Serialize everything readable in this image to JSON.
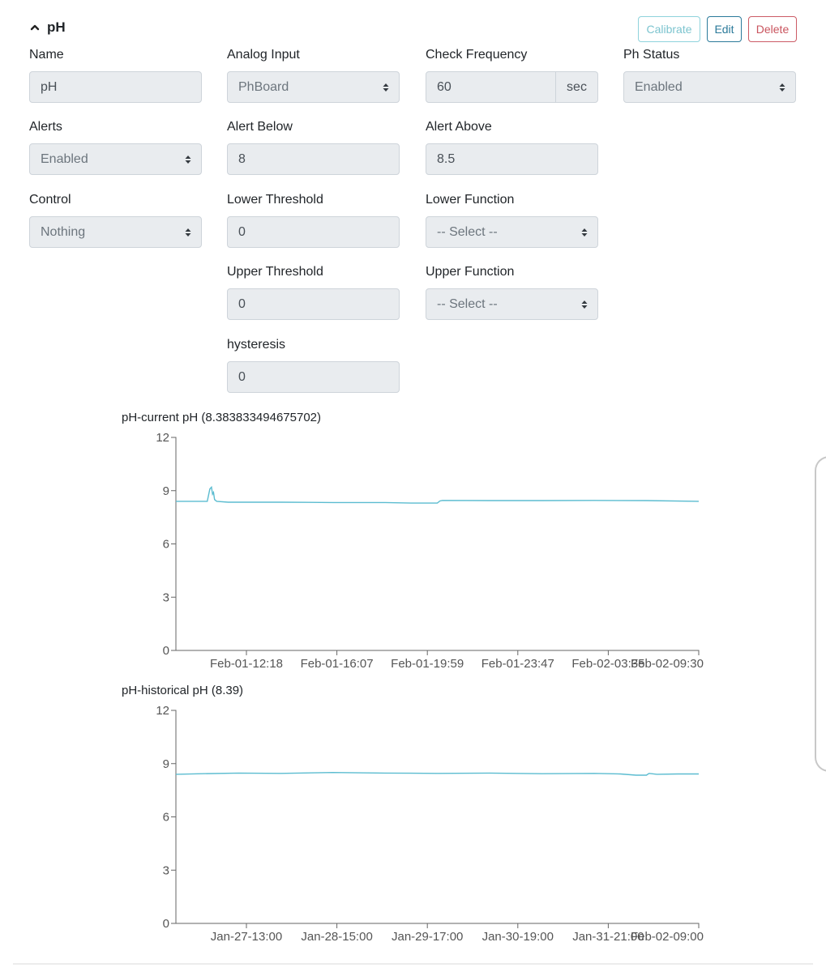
{
  "section": {
    "title": "pH",
    "collapse_icon": "chevron-up-icon"
  },
  "actions": {
    "calibrate": "Calibrate",
    "edit": "Edit",
    "delete": "Delete"
  },
  "fields": {
    "name": {
      "label": "Name",
      "value": "pH"
    },
    "analog_input": {
      "label": "Analog Input",
      "value": "PhBoard"
    },
    "check_frequency": {
      "label": "Check Frequency",
      "value": "60",
      "unit": "sec"
    },
    "ph_status": {
      "label": "Ph Status",
      "value": "Enabled"
    },
    "alerts": {
      "label": "Alerts",
      "value": "Enabled"
    },
    "alert_below": {
      "label": "Alert Below",
      "value": "8"
    },
    "alert_above": {
      "label": "Alert Above",
      "value": "8.5"
    },
    "control": {
      "label": "Control",
      "value": "Nothing"
    },
    "lower_threshold": {
      "label": "Lower Threshold",
      "value": "0"
    },
    "lower_function": {
      "label": "Lower Function",
      "value": "-- Select --"
    },
    "upper_threshold": {
      "label": "Upper Threshold",
      "value": "0"
    },
    "upper_function": {
      "label": "Upper Function",
      "value": "-- Select --"
    },
    "hysteresis": {
      "label": "hysteresis",
      "value": "0"
    }
  },
  "chart_data": [
    {
      "type": "line",
      "title": "pH-current pH (8.383833494675702)",
      "xlabel": "",
      "ylabel": "",
      "ylim": [
        0,
        12
      ],
      "yticks": [
        0,
        3,
        6,
        9,
        12
      ],
      "xticks": [
        "Feb-01-12:18",
        "Feb-01-16:07",
        "Feb-01-19:59",
        "Feb-01-23:47",
        "Feb-02-03:35",
        "Feb-02-09:30"
      ],
      "color": "#5bbcd0",
      "x": [
        0,
        0.04,
        0.06,
        0.065,
        0.068,
        0.07,
        0.072,
        0.074,
        0.078,
        0.1,
        0.2,
        0.3,
        0.4,
        0.45,
        0.5,
        0.505,
        0.51,
        0.6,
        0.7,
        0.8,
        0.9,
        1.0
      ],
      "values": [
        8.4,
        8.4,
        8.4,
        9.1,
        9.2,
        8.8,
        8.9,
        8.5,
        8.4,
        8.35,
        8.35,
        8.33,
        8.33,
        8.3,
        8.3,
        8.42,
        8.45,
        8.44,
        8.44,
        8.45,
        8.44,
        8.4
      ]
    },
    {
      "type": "line",
      "title": "pH-historical pH (8.39)",
      "xlabel": "",
      "ylabel": "",
      "ylim": [
        0,
        12
      ],
      "yticks": [
        0,
        3,
        6,
        9,
        12
      ],
      "xticks": [
        "Jan-27-13:00",
        "Jan-28-15:00",
        "Jan-29-17:00",
        "Jan-30-19:00",
        "Jan-31-21:00",
        "Feb-02-09:00"
      ],
      "color": "#5bbcd0",
      "x": [
        0,
        0.05,
        0.12,
        0.2,
        0.3,
        0.4,
        0.5,
        0.6,
        0.7,
        0.8,
        0.85,
        0.88,
        0.9,
        0.905,
        0.92,
        0.96,
        1.0
      ],
      "values": [
        8.4,
        8.43,
        8.47,
        8.45,
        8.5,
        8.47,
        8.45,
        8.47,
        8.43,
        8.45,
        8.42,
        8.35,
        8.35,
        8.45,
        8.4,
        8.42,
        8.42
      ]
    }
  ]
}
